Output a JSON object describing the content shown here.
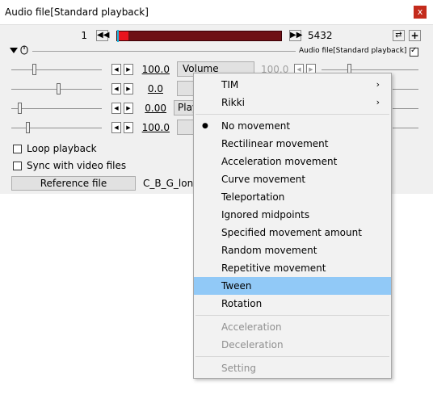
{
  "window": {
    "title": "Audio file[Standard playback]",
    "close_glyph": "x"
  },
  "playback": {
    "current_frame": "1",
    "total_frames": "5432",
    "prev_glyph": "◀◀",
    "next_glyph": "▶▶",
    "cursor_fraction": 0.0
  },
  "toolbar": {
    "camera_glyph": "⇄",
    "add_glyph": "+",
    "object_label": "Audio file[Standard playback]",
    "object_enabled": true
  },
  "params": [
    {
      "value": "100.0",
      "button_label": "Volume",
      "end_value": "100.0"
    },
    {
      "value": "0.0",
      "button_label": ""
    },
    {
      "value": "0.00",
      "button_label": "Play"
    },
    {
      "value": "100.0",
      "button_label": ""
    }
  ],
  "options": {
    "loop_label": "Loop playback",
    "loop_checked": false,
    "sync_label": "Sync with video files",
    "sync_checked": false
  },
  "reference": {
    "button_label": "Reference file",
    "file_name": "C_B_G_lone"
  },
  "menu": {
    "groups": [
      [
        {
          "label": "TIM",
          "submenu": true
        },
        {
          "label": "Rikki",
          "submenu": true
        }
      ],
      [
        {
          "label": "No movement",
          "checked": true
        },
        {
          "label": "Rectilinear movement"
        },
        {
          "label": "Acceleration movement"
        },
        {
          "label": "Curve movement"
        },
        {
          "label": "Teleportation"
        },
        {
          "label": "Ignored midpoints"
        },
        {
          "label": "Specified movement amount"
        },
        {
          "label": "Random movement"
        },
        {
          "label": "Repetitive movement"
        },
        {
          "label": "Tween",
          "highlighted": true
        },
        {
          "label": "Rotation"
        }
      ],
      [
        {
          "label": "Acceleration",
          "disabled": true
        },
        {
          "label": "Deceleration",
          "disabled": true
        }
      ],
      [
        {
          "label": "Setting",
          "disabled": true
        }
      ]
    ],
    "submenu_glyph": "›",
    "check_glyph": "●"
  },
  "colors": {
    "timeline_bg": "#6e1015",
    "timeline_cursor": "#e8141e",
    "highlight": "#91c9f7"
  }
}
